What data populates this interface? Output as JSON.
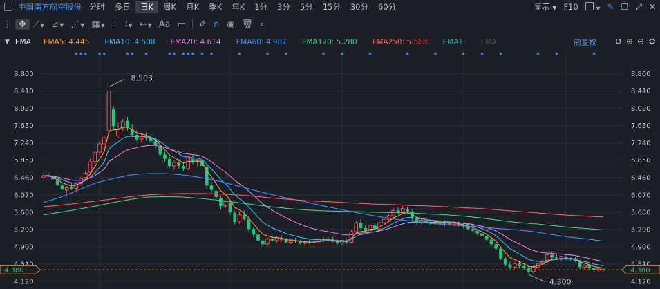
{
  "toolbar": {
    "stock_name": "中国南方航空股份",
    "periods": [
      "分时",
      "多日",
      "日K",
      "周K",
      "月K",
      "季K",
      "年K",
      "1分",
      "3分",
      "5分",
      "15分",
      "30分",
      "60分"
    ],
    "active_period": "日K",
    "display_label": "显示",
    "f10_label": "F10"
  },
  "ema_legend": {
    "title": "EMA",
    "items": [
      {
        "label": "EMA5: 4.445",
        "color": "#ff9a2a"
      },
      {
        "label": "EMA10: 4.508",
        "color": "#3ab4ff"
      },
      {
        "label": "EMA20: 4.614",
        "color": "#e07adb"
      },
      {
        "label": "EMA60: 4.987",
        "color": "#3a8dff"
      },
      {
        "label": "EMA120: 5.280",
        "color": "#43c98a"
      },
      {
        "label": "EMA250: 5.568",
        "color": "#ff5b5b"
      },
      {
        "label": "EMA1:",
        "color": "#37a0a3"
      },
      {
        "label": "EMA",
        "color": "#4b5058"
      }
    ],
    "fuquan_label": "前复权"
  },
  "chart_data": {
    "type": "candlestick",
    "ylim": [
      4.12,
      8.98
    ],
    "y_ticks": [
      "8.800",
      "8.410",
      "8.020",
      "7.630",
      "7.240",
      "6.850",
      "6.460",
      "6.070",
      "5.680",
      "5.290",
      "4.900",
      "4.510",
      "4.120"
    ],
    "current_price": "4.380",
    "annotations": [
      {
        "label": "8.503",
        "value": 8.503,
        "kind": "high"
      },
      {
        "label": "4.300",
        "value": 4.3,
        "kind": "low"
      }
    ],
    "candles": [
      {
        "o": 6.47,
        "h": 6.56,
        "l": 6.43,
        "c": 6.5
      },
      {
        "o": 6.52,
        "h": 6.58,
        "l": 6.47,
        "c": 6.48
      },
      {
        "o": 6.47,
        "h": 6.57,
        "l": 6.38,
        "c": 6.42
      },
      {
        "o": 6.42,
        "h": 6.45,
        "l": 6.27,
        "c": 6.3
      },
      {
        "o": 6.28,
        "h": 6.33,
        "l": 6.17,
        "c": 6.2
      },
      {
        "o": 6.18,
        "h": 6.27,
        "l": 6.1,
        "c": 6.23
      },
      {
        "o": 6.25,
        "h": 6.33,
        "l": 6.18,
        "c": 6.2
      },
      {
        "o": 6.22,
        "h": 6.36,
        "l": 6.17,
        "c": 6.32
      },
      {
        "o": 6.33,
        "h": 6.48,
        "l": 6.28,
        "c": 6.44
      },
      {
        "o": 6.46,
        "h": 6.62,
        "l": 6.42,
        "c": 6.56
      },
      {
        "o": 6.58,
        "h": 6.88,
        "l": 6.52,
        "c": 6.81
      },
      {
        "o": 6.82,
        "h": 7.08,
        "l": 6.77,
        "c": 7.02
      },
      {
        "o": 7.03,
        "h": 7.28,
        "l": 6.96,
        "c": 7.22
      },
      {
        "o": 7.22,
        "h": 7.42,
        "l": 7.12,
        "c": 7.36
      },
      {
        "o": 7.52,
        "h": 8.503,
        "l": 7.48,
        "c": 8.41
      },
      {
        "o": 8.0,
        "h": 8.08,
        "l": 7.55,
        "c": 7.62
      },
      {
        "o": 7.4,
        "h": 7.7,
        "l": 7.35,
        "c": 7.55
      },
      {
        "o": 7.58,
        "h": 7.78,
        "l": 7.52,
        "c": 7.72
      },
      {
        "o": 7.74,
        "h": 7.83,
        "l": 7.52,
        "c": 7.58
      },
      {
        "o": 7.56,
        "h": 7.66,
        "l": 7.38,
        "c": 7.42
      },
      {
        "o": 7.42,
        "h": 7.52,
        "l": 7.28,
        "c": 7.32
      },
      {
        "o": 7.33,
        "h": 7.46,
        "l": 7.25,
        "c": 7.4
      },
      {
        "o": 7.4,
        "h": 7.48,
        "l": 7.3,
        "c": 7.36
      },
      {
        "o": 7.36,
        "h": 7.44,
        "l": 7.22,
        "c": 7.28
      },
      {
        "o": 7.28,
        "h": 7.38,
        "l": 7.12,
        "c": 7.18
      },
      {
        "o": 7.16,
        "h": 7.2,
        "l": 6.92,
        "c": 6.98
      },
      {
        "o": 6.98,
        "h": 7.05,
        "l": 6.82,
        "c": 6.88
      },
      {
        "o": 6.88,
        "h": 6.93,
        "l": 6.68,
        "c": 6.72
      },
      {
        "o": 6.72,
        "h": 6.85,
        "l": 6.64,
        "c": 6.8
      },
      {
        "o": 6.8,
        "h": 6.88,
        "l": 6.66,
        "c": 6.72
      },
      {
        "o": 6.72,
        "h": 6.82,
        "l": 6.6,
        "c": 6.66
      },
      {
        "o": 6.66,
        "h": 6.95,
        "l": 6.62,
        "c": 6.9
      },
      {
        "o": 6.88,
        "h": 6.96,
        "l": 6.76,
        "c": 6.82
      },
      {
        "o": 6.82,
        "h": 6.9,
        "l": 6.7,
        "c": 6.86
      },
      {
        "o": 6.86,
        "h": 6.92,
        "l": 6.66,
        "c": 6.72
      },
      {
        "o": 6.7,
        "h": 6.74,
        "l": 6.2,
        "c": 6.28
      },
      {
        "o": 6.28,
        "h": 6.36,
        "l": 6.12,
        "c": 6.18
      },
      {
        "o": 6.16,
        "h": 6.18,
        "l": 5.98,
        "c": 6.02
      },
      {
        "o": 6.0,
        "h": 6.06,
        "l": 5.74,
        "c": 5.82
      },
      {
        "o": 5.82,
        "h": 5.96,
        "l": 5.77,
        "c": 5.92
      },
      {
        "o": 5.9,
        "h": 5.93,
        "l": 5.62,
        "c": 5.68
      },
      {
        "o": 5.66,
        "h": 5.7,
        "l": 5.4,
        "c": 5.46
      },
      {
        "o": 5.46,
        "h": 5.68,
        "l": 5.42,
        "c": 5.62
      },
      {
        "o": 5.62,
        "h": 5.72,
        "l": 5.48,
        "c": 5.52
      },
      {
        "o": 5.52,
        "h": 5.58,
        "l": 5.24,
        "c": 5.3
      },
      {
        "o": 5.3,
        "h": 5.35,
        "l": 5.12,
        "c": 5.18
      },
      {
        "o": 5.18,
        "h": 5.22,
        "l": 4.98,
        "c": 5.04
      },
      {
        "o": 5.04,
        "h": 5.1,
        "l": 4.9,
        "c": 4.96
      },
      {
        "o": 4.96,
        "h": 5.12,
        "l": 4.92,
        "c": 5.08
      },
      {
        "o": 5.08,
        "h": 5.14,
        "l": 5.0,
        "c": 5.04
      },
      {
        "o": 5.04,
        "h": 5.14,
        "l": 5.0,
        "c": 5.1
      },
      {
        "o": 5.1,
        "h": 5.16,
        "l": 5.02,
        "c": 5.06
      },
      {
        "o": 5.06,
        "h": 5.1,
        "l": 4.98,
        "c": 5.0
      },
      {
        "o": 5.0,
        "h": 5.08,
        "l": 4.96,
        "c": 5.04
      },
      {
        "o": 5.04,
        "h": 5.1,
        "l": 4.98,
        "c": 5.02
      },
      {
        "o": 5.02,
        "h": 5.06,
        "l": 4.94,
        "c": 4.98
      },
      {
        "o": 4.98,
        "h": 5.04,
        "l": 4.94,
        "c": 5.0
      },
      {
        "o": 5.0,
        "h": 5.05,
        "l": 4.96,
        "c": 4.99
      },
      {
        "o": 4.99,
        "h": 5.03,
        "l": 4.95,
        "c": 5.01
      },
      {
        "o": 5.01,
        "h": 5.1,
        "l": 4.98,
        "c": 5.06
      },
      {
        "o": 5.06,
        "h": 5.12,
        "l": 5.0,
        "c": 5.04
      },
      {
        "o": 5.04,
        "h": 5.12,
        "l": 5.0,
        "c": 5.08
      },
      {
        "o": 5.08,
        "h": 5.12,
        "l": 5.0,
        "c": 5.02
      },
      {
        "o": 5.02,
        "h": 5.06,
        "l": 4.94,
        "c": 4.98
      },
      {
        "o": 4.98,
        "h": 5.06,
        "l": 4.94,
        "c": 5.04
      },
      {
        "o": 5.04,
        "h": 5.08,
        "l": 4.96,
        "c": 5.0
      },
      {
        "o": 5.0,
        "h": 5.28,
        "l": 4.98,
        "c": 5.24
      },
      {
        "o": 5.24,
        "h": 5.48,
        "l": 5.2,
        "c": 5.44
      },
      {
        "o": 5.44,
        "h": 5.52,
        "l": 5.28,
        "c": 5.32
      },
      {
        "o": 5.32,
        "h": 5.38,
        "l": 5.22,
        "c": 5.26
      },
      {
        "o": 5.26,
        "h": 5.42,
        "l": 5.22,
        "c": 5.38
      },
      {
        "o": 5.38,
        "h": 5.44,
        "l": 5.26,
        "c": 5.3
      },
      {
        "o": 5.3,
        "h": 5.48,
        "l": 5.28,
        "c": 5.44
      },
      {
        "o": 5.44,
        "h": 5.56,
        "l": 5.4,
        "c": 5.52
      },
      {
        "o": 5.52,
        "h": 5.64,
        "l": 5.46,
        "c": 5.6
      },
      {
        "o": 5.6,
        "h": 5.78,
        "l": 5.56,
        "c": 5.72
      },
      {
        "o": 5.72,
        "h": 5.8,
        "l": 5.62,
        "c": 5.68
      },
      {
        "o": 5.68,
        "h": 5.82,
        "l": 5.64,
        "c": 5.76
      },
      {
        "o": 5.74,
        "h": 5.8,
        "l": 5.66,
        "c": 5.7
      },
      {
        "o": 5.7,
        "h": 5.76,
        "l": 5.48,
        "c": 5.54
      },
      {
        "o": 5.54,
        "h": 5.58,
        "l": 5.4,
        "c": 5.44
      },
      {
        "o": 5.44,
        "h": 5.54,
        "l": 5.4,
        "c": 5.5
      },
      {
        "o": 5.5,
        "h": 5.54,
        "l": 5.42,
        "c": 5.46
      },
      {
        "o": 5.46,
        "h": 5.52,
        "l": 5.4,
        "c": 5.42
      },
      {
        "o": 5.42,
        "h": 5.5,
        "l": 5.38,
        "c": 5.46
      },
      {
        "o": 5.46,
        "h": 5.5,
        "l": 5.38,
        "c": 5.42
      },
      {
        "o": 5.42,
        "h": 5.5,
        "l": 5.36,
        "c": 5.44
      },
      {
        "o": 5.44,
        "h": 5.48,
        "l": 5.38,
        "c": 5.4
      },
      {
        "o": 5.4,
        "h": 5.48,
        "l": 5.36,
        "c": 5.44
      },
      {
        "o": 5.44,
        "h": 5.48,
        "l": 5.36,
        "c": 5.38
      },
      {
        "o": 5.38,
        "h": 5.42,
        "l": 5.32,
        "c": 5.36
      },
      {
        "o": 5.36,
        "h": 5.4,
        "l": 5.28,
        "c": 5.3
      },
      {
        "o": 5.3,
        "h": 5.34,
        "l": 5.22,
        "c": 5.26
      },
      {
        "o": 5.26,
        "h": 5.3,
        "l": 5.16,
        "c": 5.2
      },
      {
        "o": 5.2,
        "h": 5.24,
        "l": 5.1,
        "c": 5.14
      },
      {
        "o": 5.14,
        "h": 5.18,
        "l": 5.02,
        "c": 5.06
      },
      {
        "o": 5.06,
        "h": 5.1,
        "l": 4.92,
        "c": 4.96
      },
      {
        "o": 4.96,
        "h": 5.0,
        "l": 4.82,
        "c": 4.86
      },
      {
        "o": 4.86,
        "h": 4.9,
        "l": 4.6,
        "c": 4.64
      },
      {
        "o": 4.64,
        "h": 4.68,
        "l": 4.46,
        "c": 4.5
      },
      {
        "o": 4.5,
        "h": 4.56,
        "l": 4.4,
        "c": 4.44
      },
      {
        "o": 4.44,
        "h": 4.56,
        "l": 4.4,
        "c": 4.52
      },
      {
        "o": 4.52,
        "h": 4.58,
        "l": 4.42,
        "c": 4.46
      },
      {
        "o": 4.46,
        "h": 4.5,
        "l": 4.38,
        "c": 4.42
      },
      {
        "o": 4.42,
        "h": 4.46,
        "l": 4.3,
        "c": 4.34
      },
      {
        "o": 4.34,
        "h": 4.48,
        "l": 4.3,
        "c": 4.44
      },
      {
        "o": 4.44,
        "h": 4.56,
        "l": 4.4,
        "c": 4.52
      },
      {
        "o": 4.52,
        "h": 4.62,
        "l": 4.48,
        "c": 4.56
      },
      {
        "o": 4.56,
        "h": 4.76,
        "l": 4.54,
        "c": 4.72
      },
      {
        "o": 4.72,
        "h": 4.8,
        "l": 4.62,
        "c": 4.66
      },
      {
        "o": 4.66,
        "h": 4.72,
        "l": 4.6,
        "c": 4.64
      },
      {
        "o": 4.64,
        "h": 4.7,
        "l": 4.58,
        "c": 4.68
      },
      {
        "o": 4.68,
        "h": 4.72,
        "l": 4.6,
        "c": 4.62
      },
      {
        "o": 4.62,
        "h": 4.68,
        "l": 4.58,
        "c": 4.64
      },
      {
        "o": 4.64,
        "h": 4.68,
        "l": 4.56,
        "c": 4.58
      },
      {
        "o": 4.58,
        "h": 4.6,
        "l": 4.4,
        "c": 4.44
      },
      {
        "o": 4.44,
        "h": 4.52,
        "l": 4.38,
        "c": 4.48
      },
      {
        "o": 4.48,
        "h": 4.52,
        "l": 4.38,
        "c": 4.42
      },
      {
        "o": 4.42,
        "h": 4.46,
        "l": 4.34,
        "c": 4.38
      },
      {
        "o": 4.38,
        "h": 4.44,
        "l": 4.34,
        "c": 4.4
      },
      {
        "o": 4.4,
        "h": 4.42,
        "l": 4.34,
        "c": 4.38
      }
    ],
    "ema_lines": [
      {
        "name": "EMA5",
        "color": "#ff9a2a",
        "period": 5
      },
      {
        "name": "EMA10",
        "color": "#3ab4ff",
        "period": 10
      },
      {
        "name": "EMA20",
        "color": "#e07adb",
        "period": 20
      },
      {
        "name": "EMA60",
        "color": "#3a8dff",
        "period": 60,
        "values": [
          5.9,
          6.02,
          6.18,
          6.34,
          6.44,
          6.52,
          6.55,
          6.55,
          6.52,
          6.46,
          6.38,
          6.28,
          6.18,
          6.08,
          5.99,
          5.91,
          5.82,
          5.74,
          5.66,
          5.59,
          5.53,
          5.48,
          5.43,
          5.4,
          5.37,
          5.34,
          5.31,
          5.28,
          5.24,
          5.18,
          5.12,
          5.08,
          5.03
        ]
      },
      {
        "name": "EMA120",
        "color": "#43c98a",
        "period": 120,
        "values": [
          5.62,
          5.68,
          5.75,
          5.82,
          5.9,
          5.97,
          6.02,
          6.03,
          6.02,
          5.99,
          5.95,
          5.9,
          5.85,
          5.8,
          5.76,
          5.73,
          5.71,
          5.7,
          5.69,
          5.68,
          5.67,
          5.66,
          5.64,
          5.62,
          5.59,
          5.55,
          5.5,
          5.45,
          5.42,
          5.38,
          5.34,
          5.31,
          5.28
        ]
      },
      {
        "name": "EMA250",
        "color": "#ff5b5b",
        "period": 250,
        "values": [
          5.8,
          5.84,
          5.88,
          5.93,
          5.98,
          6.03,
          6.07,
          6.09,
          6.1,
          6.1,
          6.09,
          6.07,
          6.04,
          6.0,
          5.97,
          5.94,
          5.92,
          5.9,
          5.88,
          5.86,
          5.85,
          5.83,
          5.82,
          5.8,
          5.78,
          5.76,
          5.73,
          5.7,
          5.67,
          5.64,
          5.61,
          5.59,
          5.57
        ]
      }
    ]
  }
}
